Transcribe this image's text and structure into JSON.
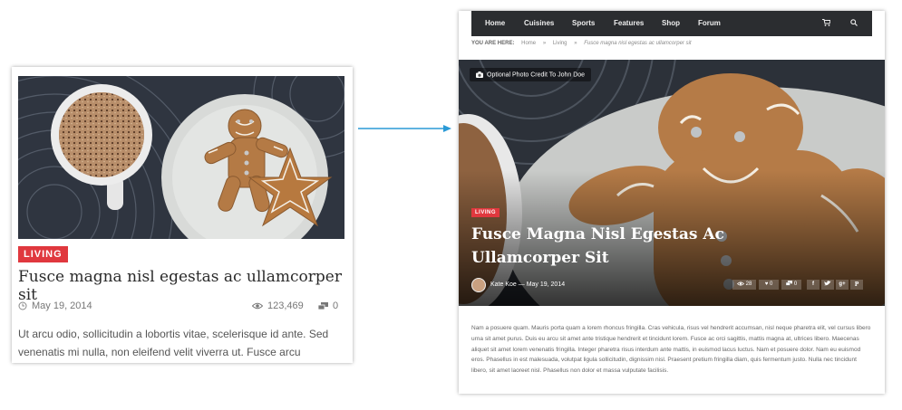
{
  "card": {
    "category": "LIVING",
    "title": "Fusce magna nisl egestas ac ullamcorper sit",
    "date": "May 19, 2014",
    "views": "123,469",
    "comments": "0",
    "excerpt": "Ut arcu odio, sollicitudin a lobortis vitae, scelerisque id ante. Sed venenatis mi nulla, non eleifend velit viverra ut. Fusce arcu"
  },
  "preview": {
    "nav": {
      "items": [
        "Home",
        "Cuisines",
        "Sports",
        "Features",
        "Shop",
        "Forum"
      ],
      "cart_icon": "cart-icon",
      "search_icon": "search-icon"
    },
    "breadcrumb": {
      "label": "YOU ARE HERE:",
      "items": [
        "Home",
        "Living"
      ],
      "separator": "»",
      "current": "Fusce magna nisl egestas ac ullamcorper sit"
    },
    "photo_credit": "Optional Photo Credit To John Doe",
    "category": "LIVING",
    "title": "Fusce Magna Nisl Egestas Ac Ullamcorper Sit",
    "author_line": "Kate Koe — May 19, 2014",
    "stats": {
      "views": "28",
      "likes": "0",
      "comments": "0"
    },
    "share_icons": [
      "facebook-icon",
      "twitter-icon",
      "google-plus-icon",
      "pinterest-icon"
    ],
    "body": "Nam a posuere quam. Mauris porta quam a lorem rhoncus fringilla. Cras vehicula, risus vel hendrerit accumsan, nisl neque pharetra elit, vel cursus libero urna sit amet purus. Duis eu arcu sit amet ante tristique hendrerit et tincidunt lorem. Fusce ac orci sagittis, mattis magna at, ultrices libero. Maecenas aliquet sit amet lorem venenatis fringilla. Integer pharetra risus interdum ante mattis, in euismod lacus luctus. Nam et posuere dolor. Nam eu euismod eros. Phasellus in est malesuada, volutpat ligula sollicitudin, dignissim nisl. Praesent pretium fringilla diam, quis fermentum justo. Nulla nec tincidunt libero, sit amet laoreet nisl. Phasellus non dolor et massa vulputate facilisis."
  },
  "colors": {
    "accent": "#e0383e",
    "nav_bg": "#2b2d30",
    "arrow": "#2a9ad6"
  }
}
